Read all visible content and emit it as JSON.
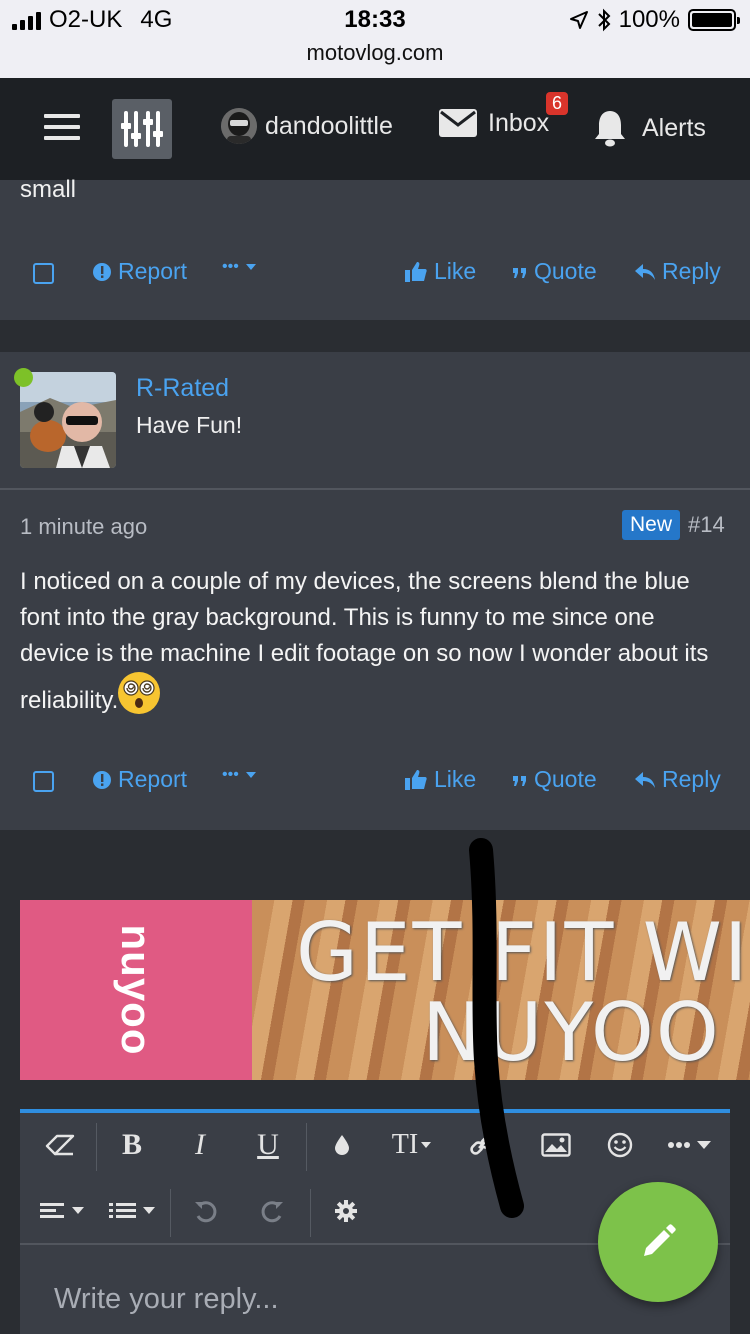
{
  "status_bar": {
    "carrier": "O2-UK",
    "network": "4G",
    "time": "18:33",
    "url": "motovlog.com",
    "battery": "100%"
  },
  "nav": {
    "username": "dandoolittle",
    "inbox_label": "Inbox",
    "inbox_count": "6",
    "alerts_label": "Alerts"
  },
  "previous_post": {
    "text_fragment": "small",
    "actions": {
      "report": "Report",
      "more": "•••",
      "like": "Like",
      "quote": "Quote",
      "reply": "Reply"
    }
  },
  "post": {
    "author": "R-Rated",
    "user_title": "Have Fun!",
    "time": "1 minute ago",
    "new_badge": "New",
    "post_number": "#14",
    "body": "I noticed on a couple of my devices, the screens blend the blue font into the gray background. This is funny to me since one device is the machine I edit footage on so now I wonder about its reliability.",
    "actions": {
      "report": "Report",
      "more": "•••",
      "like": "Like",
      "quote": "Quote",
      "reply": "Reply"
    }
  },
  "ad": {
    "brand": "nuyoo",
    "headline_line1": "GET FIT WI",
    "headline_line2": "NUYOO"
  },
  "editor": {
    "placeholder": "Write your reply...",
    "bold": "B",
    "italic": "I",
    "underline": "U",
    "text_size": "TI"
  },
  "colors": {
    "accent_blue": "#4aa3f0",
    "card_bg": "#3a3e46",
    "nav_bg": "#1d2024",
    "online_green": "#7dc128",
    "fab_green": "#7dc24a",
    "badge_red": "#d9342b"
  }
}
